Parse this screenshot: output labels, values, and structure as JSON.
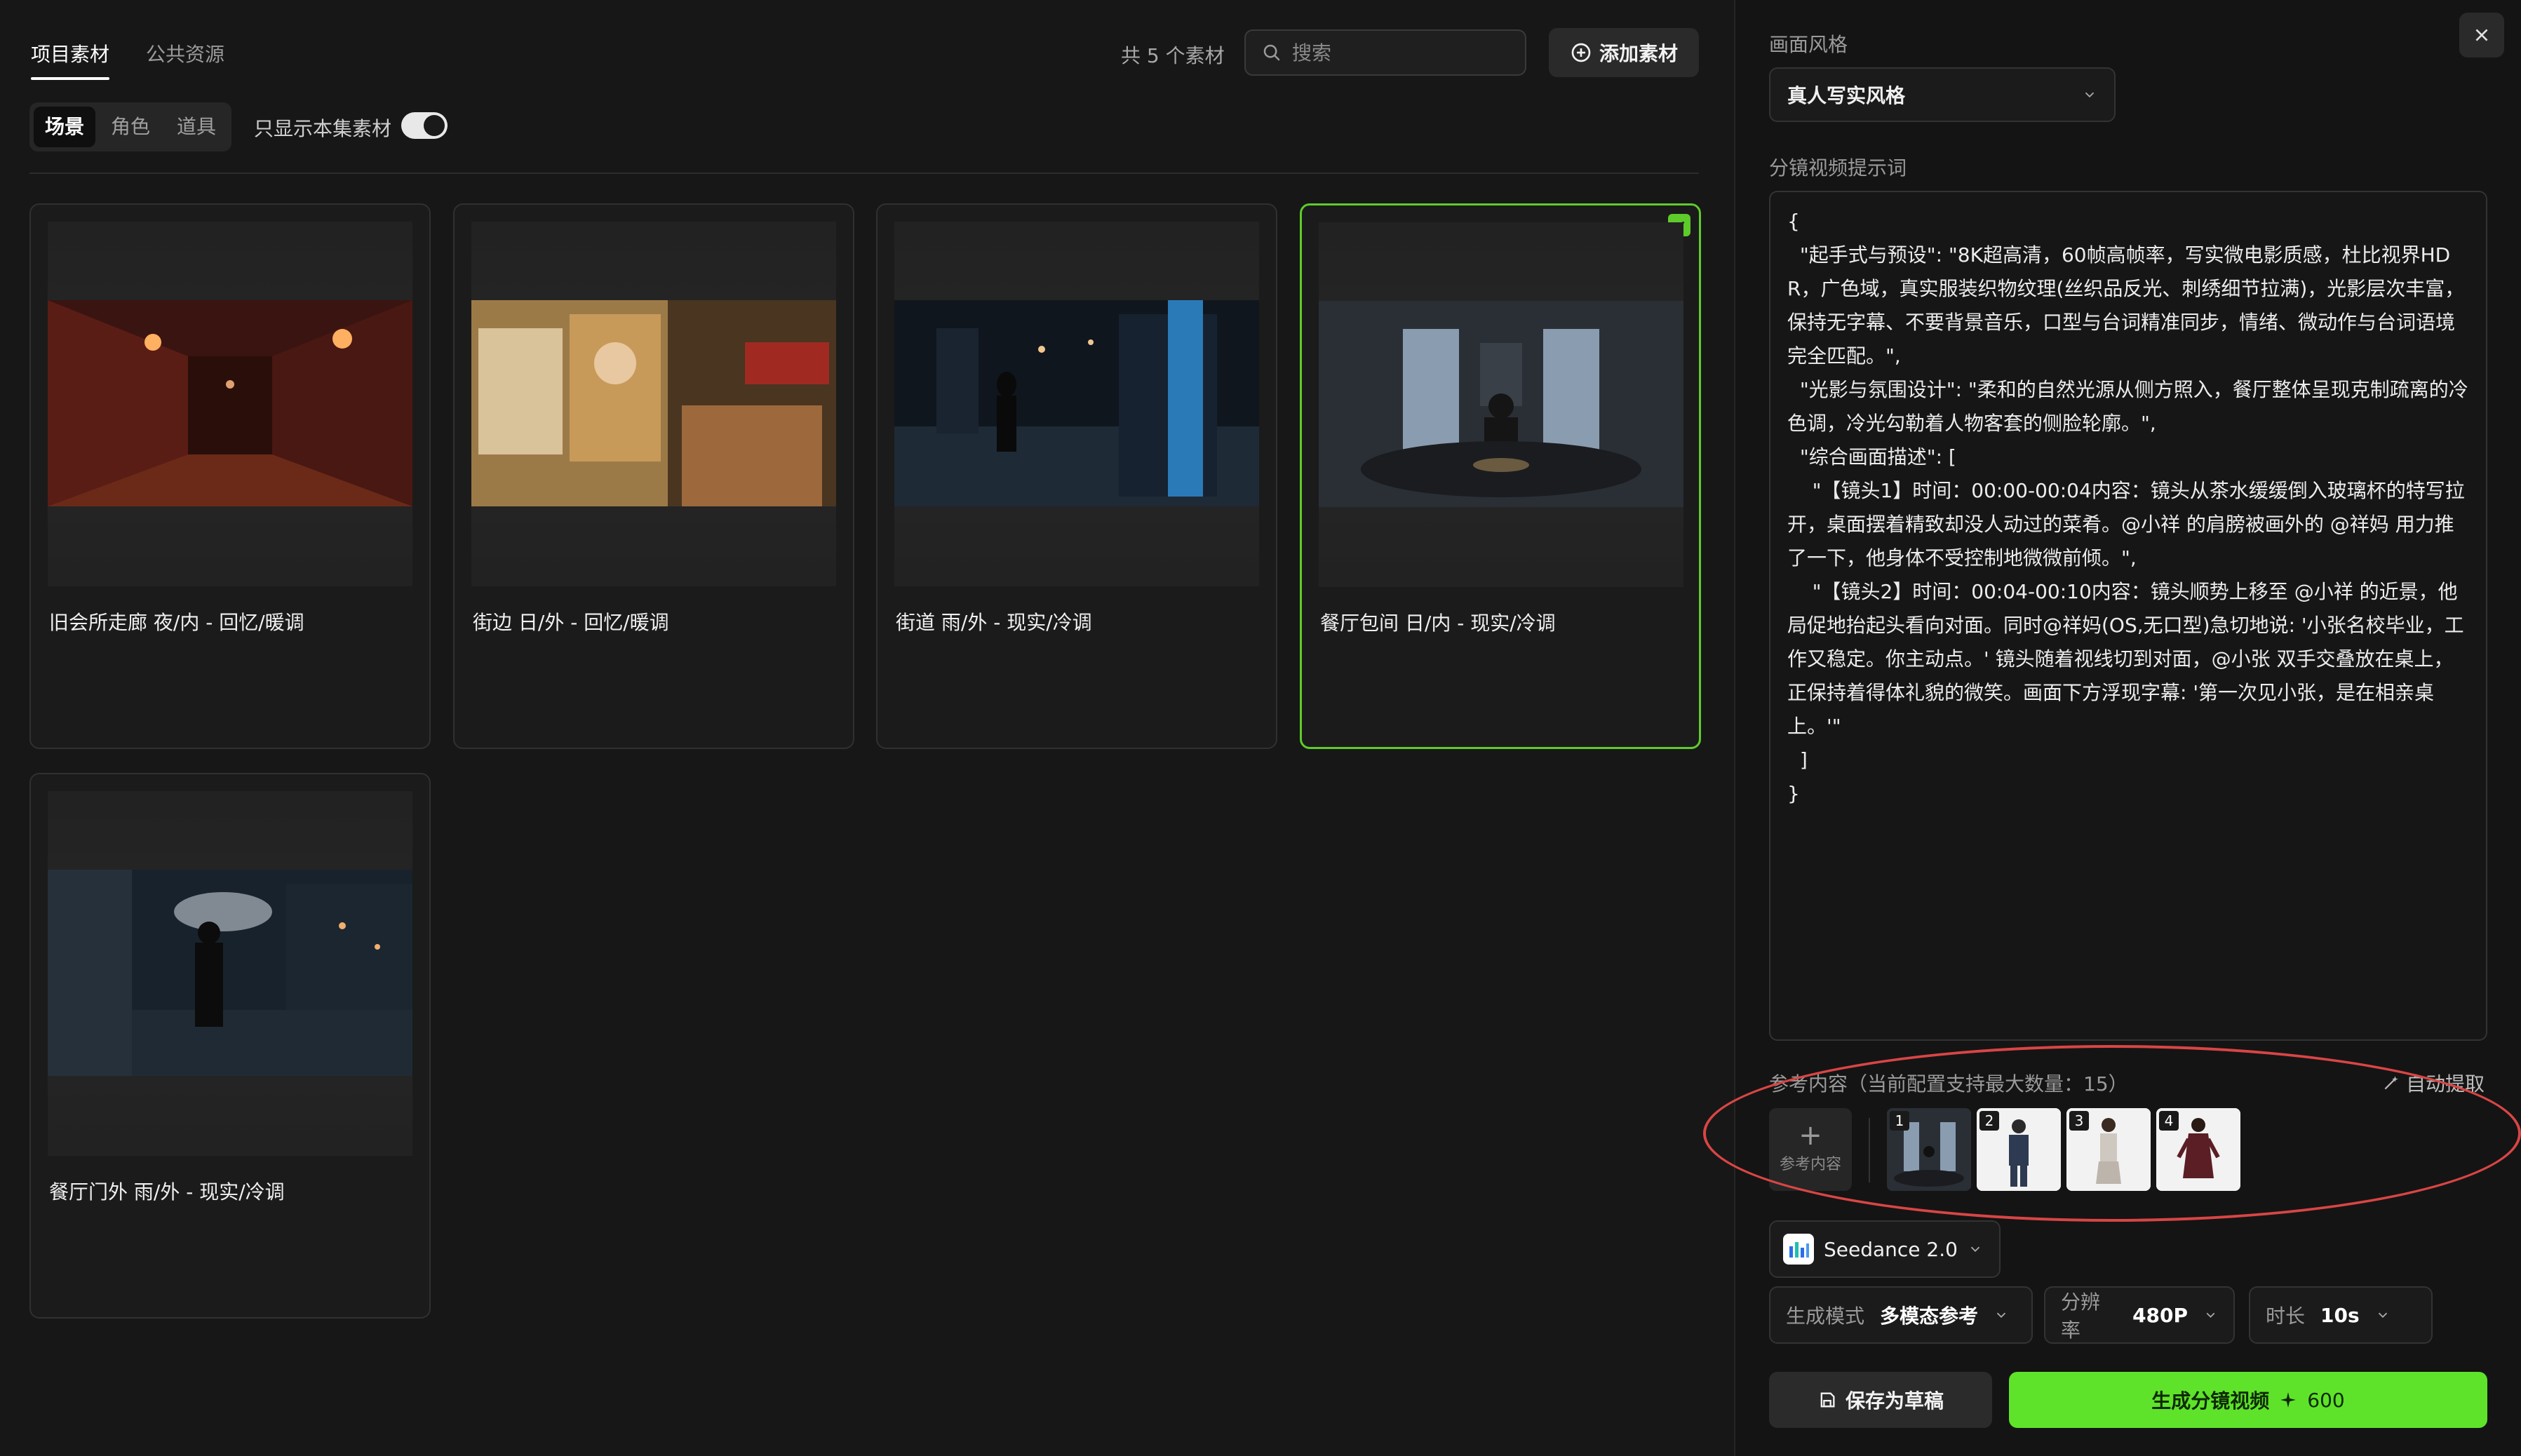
{
  "tabs": [
    {
      "label": "项目素材",
      "active": true
    },
    {
      "label": "公共资源",
      "active": false
    }
  ],
  "asset_count": "共 5 个素材",
  "search": {
    "placeholder": "搜索",
    "value": ""
  },
  "add_button": "添加素材",
  "segments": [
    {
      "label": "场景",
      "active": true
    },
    {
      "label": "角色",
      "active": false
    },
    {
      "label": "道具",
      "active": false
    }
  ],
  "only_current_toggle": {
    "label": "只显示本集素材",
    "on": true
  },
  "cards": [
    {
      "title": "旧会所走廊 夜/内 - 回忆/暖调",
      "selected": false
    },
    {
      "title": "街边 日/外 - 回忆/暖调",
      "selected": false
    },
    {
      "title": "街道 雨/外 - 现实/冷调",
      "selected": false
    },
    {
      "title": "餐厅包间 日/内 - 现实/冷调",
      "selected": true
    },
    {
      "title": "餐厅门外 雨/外 - 现实/冷调",
      "selected": false
    }
  ],
  "panel": {
    "style_label": "画面风格",
    "style_value": "真人写实风格",
    "prompt_label": "分镜视频提示词",
    "prompt_text": "{\n  \"起手式与预设\": \"8K超高清，60帧高帧率，写实微电影质感，杜比视界HDR，广色域，真实服装织物纹理(丝织品反光、刺绣细节拉满)，光影层次丰富，保持无字幕、不要背景音乐，口型与台词精准同步，情绪、微动作与台词语境完全匹配。\",\n  \"光影与氛围设计\": \"柔和的自然光源从侧方照入，餐厅整体呈现克制疏离的冷色调，冷光勾勒着人物客套的侧脸轮廓。\",\n  \"综合画面描述\": [\n    \"【镜头1】时间：00:00-00:04内容：镜头从茶水缓缓倒入玻璃杯的特写拉开，桌面摆着精致却没人动过的菜肴。@小祥 的肩膀被画外的 @祥妈 用力推了一下，他身体不受控制地微微前倾。\",\n    \"【镜头2】时间：00:04-00:10内容：镜头顺势上移至 @小祥 的近景，他局促地抬起头看向对面。同时@祥妈(OS,无口型)急切地说: '小张名校毕业，工作又稳定。你主动点。' 镜头随着视线切到对面，@小张 双手交叠放在桌上，正保持着得体礼貌的微笑。画面下方浮现字幕: '第一次见小张，是在相亲桌上。'\"\n  ]\n}",
    "ref_title": "参考内容（当前配置支持最大数量：15）",
    "auto_extract": "自动提取",
    "ref_add_label": "参考内容",
    "ref_items": [
      "1",
      "2",
      "3",
      "4"
    ],
    "model": "Seedance 2.0",
    "params": [
      {
        "key": "生成模式",
        "value": "多模态参考"
      },
      {
        "key": "分辨率",
        "value": "480P"
      },
      {
        "key": "时长",
        "value": "10s"
      }
    ],
    "save_draft": "保存为草稿",
    "generate": "生成分镜视频",
    "generate_cost": "600"
  },
  "colors": {
    "accent_green": "#5ee32a",
    "annotation_red": "#d94545"
  }
}
